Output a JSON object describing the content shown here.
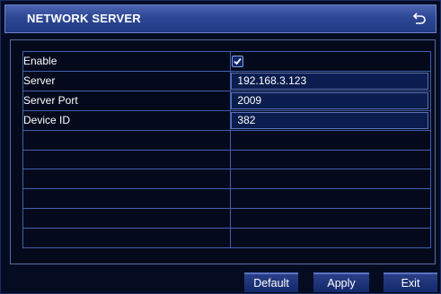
{
  "dialog": {
    "title": "NETWORK SERVER",
    "back_icon": "return-arrow-icon"
  },
  "form": {
    "rows": [
      {
        "label": "Enable",
        "type": "checkbox",
        "checked": true
      },
      {
        "label": "Server",
        "type": "text",
        "value": "192.168.3.123"
      },
      {
        "label": "Server Port",
        "type": "text",
        "value": "2009"
      },
      {
        "label": "Device ID",
        "type": "text",
        "value": "382"
      }
    ],
    "empty_rows": 6
  },
  "buttons": {
    "default_label": "Default",
    "apply_label": "Apply",
    "exit_label": "Exit"
  },
  "colors": {
    "accent": "#203a84",
    "grid_line": "#3f5fb0",
    "background": "#050c22"
  }
}
